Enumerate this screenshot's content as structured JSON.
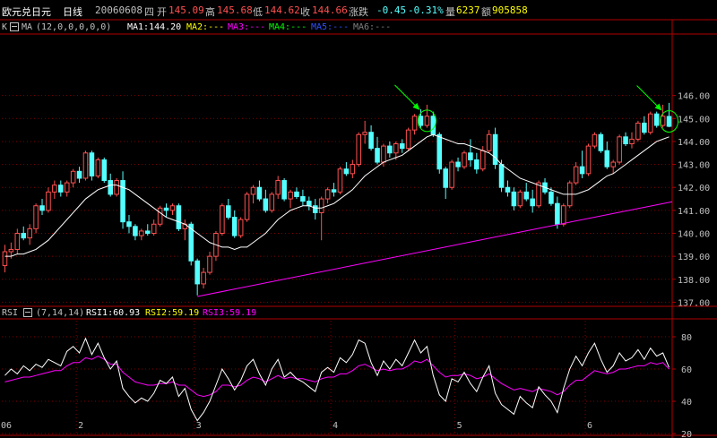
{
  "header": {
    "symbol": "欧元兑日元",
    "period": "日线",
    "date": "20060608",
    "weekday": "四",
    "open_label": "开",
    "open": "145.09",
    "high_label": "高",
    "high": "145.68",
    "low_label": "低",
    "low": "144.62",
    "close_label": "收",
    "close": "144.66",
    "change_label": "涨跌",
    "change": "-0.45",
    "change_pct": "-0.31%",
    "volume_label": "量",
    "volume": "6237",
    "amount_label": "额",
    "amount": "905858"
  },
  "main_legend": {
    "k": "K",
    "ma": "MA",
    "params": "(12,0,0,0,0,0)",
    "ma1": "MA1:144.20",
    "ma2": "MA2:---",
    "ma3": "MA3:---",
    "ma4": "MA4:---",
    "ma5": "MA5:---",
    "ma6": "MA6:---"
  },
  "rsi_legend": {
    "name": "RSI",
    "params": "(7,14,14)",
    "rsi1": "RSI1:60.93",
    "rsi2": "RSI2:59.19",
    "rsi3": "RSI3:59.19"
  },
  "colors": {
    "up": "#ff5050",
    "down": "#54ffff",
    "ma1": "#ffffff",
    "trend": "#ff00ff",
    "grid": "#800000",
    "axis": "#b00000",
    "arrow": "#00ff00",
    "rsi1": "#ffffff",
    "rsi2": "#ff00ff",
    "ma2": "#ffff00",
    "ma3": "#ff00ff",
    "ma4": "#00ff00",
    "ma5": "#0000ff",
    "ma6": "#808080"
  },
  "chart_data": [
    {
      "type": "candlestick",
      "title": "",
      "ylim": [
        136.9,
        148.6
      ],
      "y_ticks": [
        "137.00",
        "138.00",
        "139.00",
        "140.00",
        "141.00",
        "142.00",
        "143.00",
        "144.00",
        "145.00",
        "146.00"
      ],
      "candles": [
        [
          138.6,
          139.5,
          138.3,
          139.2
        ],
        [
          139.2,
          139.6,
          138.9,
          139.3
        ],
        [
          139.3,
          140.2,
          139.1,
          140.0
        ],
        [
          140.0,
          140.3,
          139.7,
          139.8
        ],
        [
          139.8,
          140.4,
          139.5,
          140.2
        ],
        [
          140.2,
          141.3,
          140.0,
          141.2
        ],
        [
          141.2,
          141.5,
          140.8,
          141.0
        ],
        [
          141.0,
          142.0,
          140.9,
          141.8
        ],
        [
          141.8,
          142.3,
          141.5,
          142.1
        ],
        [
          142.1,
          142.3,
          141.6,
          141.8
        ],
        [
          141.8,
          142.3,
          141.6,
          142.2
        ],
        [
          142.2,
          142.8,
          142.0,
          142.7
        ],
        [
          142.7,
          142.9,
          142.2,
          142.4
        ],
        [
          142.4,
          143.6,
          142.3,
          143.5
        ],
        [
          143.5,
          143.6,
          142.3,
          142.5
        ],
        [
          142.5,
          143.3,
          142.4,
          143.2
        ],
        [
          143.2,
          143.3,
          142.2,
          142.3
        ],
        [
          142.3,
          142.6,
          141.6,
          141.7
        ],
        [
          141.7,
          142.4,
          141.6,
          142.3
        ],
        [
          142.3,
          142.7,
          140.2,
          140.5
        ],
        [
          140.5,
          140.8,
          140.0,
          140.3
        ],
        [
          140.3,
          140.4,
          139.7,
          139.9
        ],
        [
          139.9,
          140.2,
          139.7,
          140.1
        ],
        [
          140.1,
          140.4,
          139.9,
          140.0
        ],
        [
          140.0,
          140.6,
          139.9,
          140.4
        ],
        [
          140.4,
          141.2,
          140.3,
          141.1
        ],
        [
          141.1,
          141.3,
          140.7,
          141.0
        ],
        [
          141.0,
          141.3,
          140.8,
          141.2
        ],
        [
          141.2,
          141.3,
          140.1,
          140.2
        ],
        [
          140.2,
          140.6,
          139.7,
          140.4
        ],
        [
          140.4,
          140.5,
          138.6,
          138.8
        ],
        [
          138.8,
          138.9,
          137.3,
          137.8
        ],
        [
          137.8,
          138.5,
          137.6,
          138.3
        ],
        [
          138.3,
          139.2,
          138.2,
          139.0
        ],
        [
          139.0,
          140.1,
          138.8,
          140.0
        ],
        [
          140.0,
          141.3,
          139.9,
          141.2
        ],
        [
          141.2,
          141.5,
          140.6,
          140.7
        ],
        [
          140.7,
          141.0,
          139.8,
          139.9
        ],
        [
          139.9,
          140.7,
          139.8,
          140.6
        ],
        [
          140.6,
          141.8,
          140.5,
          141.7
        ],
        [
          141.7,
          142.1,
          141.3,
          142.0
        ],
        [
          142.0,
          142.3,
          141.4,
          141.5
        ],
        [
          141.5,
          141.9,
          140.9,
          141.0
        ],
        [
          141.0,
          141.8,
          140.9,
          141.7
        ],
        [
          141.7,
          142.5,
          141.5,
          142.3
        ],
        [
          142.3,
          142.4,
          141.4,
          141.5
        ],
        [
          141.5,
          141.9,
          141.1,
          141.8
        ],
        [
          141.8,
          142.0,
          141.5,
          141.6
        ],
        [
          141.6,
          141.9,
          141.2,
          141.4
        ],
        [
          141.4,
          141.6,
          141.0,
          141.2
        ],
        [
          141.2,
          141.5,
          140.6,
          140.9
        ],
        [
          140.9,
          141.6,
          139.7,
          141.5
        ],
        [
          141.5,
          142.0,
          141.3,
          141.9
        ],
        [
          141.9,
          142.2,
          141.6,
          141.8
        ],
        [
          141.8,
          142.9,
          141.7,
          142.8
        ],
        [
          142.8,
          143.1,
          142.5,
          142.6
        ],
        [
          142.6,
          143.2,
          142.4,
          143.0
        ],
        [
          143.0,
          144.4,
          142.9,
          144.3
        ],
        [
          144.3,
          144.9,
          143.9,
          144.4
        ],
        [
          144.4,
          144.7,
          143.6,
          143.7
        ],
        [
          143.7,
          144.2,
          143.0,
          143.1
        ],
        [
          143.1,
          143.9,
          142.9,
          143.8
        ],
        [
          143.8,
          144.0,
          143.3,
          143.5
        ],
        [
          143.5,
          144.0,
          143.2,
          143.9
        ],
        [
          143.9,
          144.1,
          143.5,
          143.7
        ],
        [
          143.7,
          144.6,
          143.6,
          144.5
        ],
        [
          144.5,
          145.2,
          144.3,
          145.1
        ],
        [
          145.1,
          145.4,
          144.6,
          144.7
        ],
        [
          144.7,
          145.6,
          144.6,
          145.1
        ],
        [
          145.1,
          145.3,
          144.2,
          144.3
        ],
        [
          144.3,
          144.4,
          142.6,
          142.8
        ],
        [
          142.8,
          142.9,
          141.5,
          142.0
        ],
        [
          142.0,
          143.2,
          141.9,
          143.1
        ],
        [
          143.1,
          143.3,
          142.7,
          142.9
        ],
        [
          142.9,
          143.6,
          142.8,
          143.5
        ],
        [
          143.5,
          144.1,
          142.9,
          143.2
        ],
        [
          143.2,
          143.5,
          142.6,
          142.8
        ],
        [
          142.8,
          143.8,
          142.7,
          143.6
        ],
        [
          143.6,
          144.5,
          143.5,
          144.3
        ],
        [
          144.3,
          144.6,
          142.8,
          143.0
        ],
        [
          143.0,
          143.2,
          141.8,
          142.0
        ],
        [
          142.0,
          142.3,
          141.6,
          141.8
        ],
        [
          141.8,
          142.0,
          141.0,
          141.2
        ],
        [
          141.2,
          141.9,
          141.1,
          141.8
        ],
        [
          141.8,
          142.2,
          141.4,
          141.5
        ],
        [
          141.5,
          141.9,
          140.9,
          141.2
        ],
        [
          141.2,
          142.3,
          141.1,
          142.2
        ],
        [
          142.2,
          142.4,
          141.7,
          141.8
        ],
        [
          141.8,
          142.0,
          141.2,
          141.3
        ],
        [
          141.3,
          141.6,
          140.2,
          140.4
        ],
        [
          140.4,
          141.3,
          140.3,
          141.2
        ],
        [
          141.2,
          142.3,
          141.1,
          142.2
        ],
        [
          142.2,
          143.1,
          142.1,
          142.9
        ],
        [
          142.9,
          143.6,
          142.4,
          142.6
        ],
        [
          142.6,
          143.9,
          142.5,
          143.8
        ],
        [
          143.8,
          144.4,
          143.7,
          144.3
        ],
        [
          144.3,
          144.4,
          143.5,
          143.6
        ],
        [
          143.6,
          144.0,
          142.8,
          142.9
        ],
        [
          142.9,
          143.2,
          142.6,
          143.1
        ],
        [
          143.1,
          144.3,
          143.0,
          144.2
        ],
        [
          144.2,
          144.4,
          143.8,
          143.9
        ],
        [
          143.9,
          144.4,
          143.7,
          144.1
        ],
        [
          144.1,
          144.9,
          144.0,
          144.8
        ],
        [
          144.8,
          145.1,
          144.3,
          144.4
        ],
        [
          144.4,
          145.3,
          144.3,
          145.2
        ],
        [
          145.2,
          145.3,
          144.6,
          144.7
        ],
        [
          144.7,
          145.6,
          144.6,
          145.1
        ],
        [
          145.09,
          145.68,
          144.62,
          144.66
        ]
      ],
      "ma1": [
        139.0,
        139.0,
        139.1,
        139.1,
        139.2,
        139.3,
        139.5,
        139.7,
        140.0,
        140.3,
        140.6,
        140.9,
        141.2,
        141.5,
        141.7,
        141.9,
        142.0,
        142.1,
        142.1,
        142.0,
        141.9,
        141.7,
        141.5,
        141.3,
        141.1,
        140.9,
        140.7,
        140.6,
        140.5,
        140.4,
        140.2,
        140.0,
        139.8,
        139.6,
        139.5,
        139.4,
        139.4,
        139.3,
        139.4,
        139.4,
        139.6,
        139.8,
        140.0,
        140.3,
        140.6,
        140.8,
        141.0,
        141.1,
        141.2,
        141.2,
        141.1,
        141.1,
        141.2,
        141.3,
        141.5,
        141.7,
        141.9,
        142.2,
        142.5,
        142.7,
        142.9,
        143.1,
        143.2,
        143.3,
        143.4,
        143.6,
        143.8,
        144.0,
        144.2,
        144.3,
        144.2,
        144.1,
        144.0,
        143.9,
        143.9,
        143.8,
        143.7,
        143.6,
        143.5,
        143.3,
        143.0,
        142.8,
        142.6,
        142.4,
        142.3,
        142.2,
        142.1,
        142.0,
        141.9,
        141.8,
        141.7,
        141.7,
        141.7,
        141.8,
        141.9,
        142.1,
        142.3,
        142.5,
        142.6,
        142.8,
        143.0,
        143.2,
        143.4,
        143.6,
        143.8,
        144.0,
        144.1,
        144.2
      ],
      "trendline": {
        "from": [
          31,
          137.25
        ],
        "to": [
          107,
          141.35
        ]
      }
    },
    {
      "type": "line",
      "title": "",
      "ylim": [
        20,
        90
      ],
      "y_ticks": [
        "20",
        "40",
        "60",
        "80"
      ],
      "x_labels": [
        "06",
        "2",
        "3",
        "4",
        "5",
        "6"
      ],
      "x_label_index": [
        0,
        12,
        31,
        53,
        73,
        94
      ],
      "series": [
        {
          "name": "RSI1",
          "values": [
            56,
            60,
            57,
            62,
            59,
            63,
            61,
            66,
            64,
            62,
            71,
            74,
            70,
            79,
            69,
            76,
            67,
            60,
            65,
            48,
            43,
            39,
            42,
            40,
            45,
            53,
            51,
            55,
            43,
            48,
            35,
            28,
            33,
            40,
            50,
            60,
            54,
            47,
            53,
            62,
            66,
            57,
            50,
            60,
            66,
            55,
            58,
            54,
            52,
            49,
            46,
            58,
            61,
            58,
            67,
            64,
            69,
            78,
            76,
            64,
            56,
            65,
            60,
            66,
            62,
            70,
            78,
            70,
            74,
            56,
            44,
            40,
            54,
            52,
            58,
            51,
            46,
            55,
            62,
            45,
            38,
            35,
            32,
            43,
            39,
            36,
            49,
            44,
            40,
            33,
            48,
            60,
            68,
            62,
            70,
            76,
            66,
            58,
            62,
            70,
            65,
            67,
            72,
            66,
            73,
            68,
            70,
            61
          ]
        },
        {
          "name": "RSI2",
          "values": [
            52,
            53,
            54,
            55,
            55,
            56,
            57,
            58,
            59,
            59,
            62,
            64,
            64,
            67,
            66,
            68,
            66,
            63,
            63,
            58,
            55,
            52,
            51,
            50,
            50,
            51,
            51,
            52,
            50,
            50,
            47,
            44,
            43,
            44,
            46,
            50,
            50,
            49,
            50,
            53,
            55,
            54,
            52,
            54,
            56,
            54,
            55,
            54,
            54,
            53,
            52,
            54,
            55,
            55,
            57,
            57,
            59,
            62,
            63,
            61,
            59,
            60,
            59,
            60,
            60,
            62,
            65,
            64,
            66,
            62,
            58,
            55,
            56,
            56,
            57,
            56,
            54,
            55,
            57,
            54,
            51,
            49,
            47,
            48,
            47,
            46,
            48,
            47,
            46,
            44,
            46,
            50,
            53,
            53,
            56,
            59,
            58,
            57,
            58,
            60,
            60,
            61,
            62,
            62,
            64,
            63,
            64,
            60
          ]
        }
      ]
    }
  ]
}
